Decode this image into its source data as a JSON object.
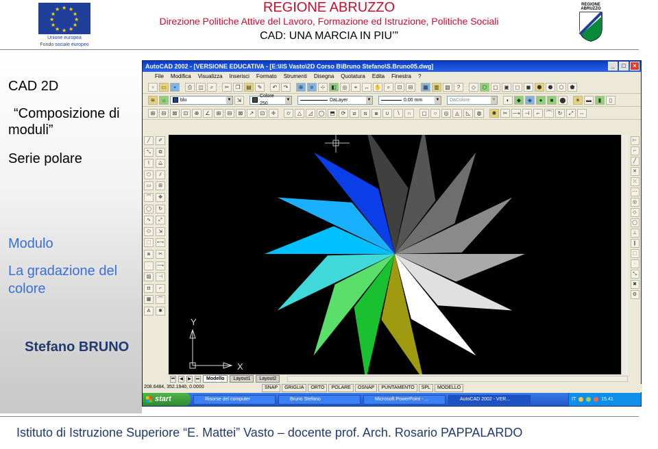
{
  "header": {
    "region_name": "REGIONE ABRUZZO",
    "directorate": "Direzione Politiche Attive del Lavoro, Formazione ed Istruzione, Politiche Sociali",
    "course_title": "CAD: UNA MARCIA IN PIU’”",
    "eu_logo_caption_1": "Unione europea",
    "eu_logo_caption_2": "Fondo sociale europeo",
    "region_logo_text_1": "REGIONE",
    "region_logo_text_2": "ABRUZZO"
  },
  "left_pane": {
    "line1": "CAD 2D",
    "line2": "“Composizione di",
    "line3": "moduli”",
    "line4": "Serie polare",
    "line5": "Modulo",
    "line6": "La gradazione del",
    "line7": "colore",
    "author": "Stefano BRUNO"
  },
  "autocad": {
    "title": "AutoCAD 2002 - [VERSIONE EDUCATIVA - [E:\\IIS Vasto\\2D Corso B\\Bruno Stefano\\S.Bruno05.dwg]",
    "menu": [
      "File",
      "Modifica",
      "Visualizza",
      "Inserisci",
      "Formato",
      "Strumenti",
      "Disegna",
      "Quotatura",
      "Edita",
      "Finestra",
      "?"
    ],
    "layer_value": "blu",
    "color_value": "Colore 250",
    "linetype_value": "DaLayer",
    "lineweight_value": "0.00 mm",
    "plotstyle_value": "DaColore",
    "ucs_y": "Y",
    "ucs_x": "X",
    "tabs": [
      "Modello",
      "Layout1",
      "Layout2"
    ],
    "coords": "208.6484, 352.1940, 0.0000",
    "status_toggles": [
      "SNAP",
      "GRIGLIA",
      "ORTO",
      "POLARE",
      "OSNAP",
      "PUNTAMENTO",
      "SPL",
      "MODELLO"
    ],
    "taskbar": {
      "start": "start",
      "tasks": [
        "Risorse del computer",
        "Bruno Stefano",
        "Microsoft PowerPoint - ...",
        "AutoCAD 2002 - VER..."
      ],
      "lang": "IT",
      "clock": "15.41"
    }
  },
  "star_colors": [
    "#00c0ff",
    "#19b0ff",
    "#0a3ee8",
    "#404040",
    "#555555",
    "#6e6e6e",
    "#8a8a8a",
    "#aaaaaa",
    "#e0e0e0",
    "#ffffff",
    "#a09a10",
    "#19c030",
    "#5ae06a",
    "#40d8d8"
  ],
  "footer": "Istituto di Istruzione Superiore “E. Mattei” Vasto – docente prof. Arch. Rosario PAPPALARDO"
}
